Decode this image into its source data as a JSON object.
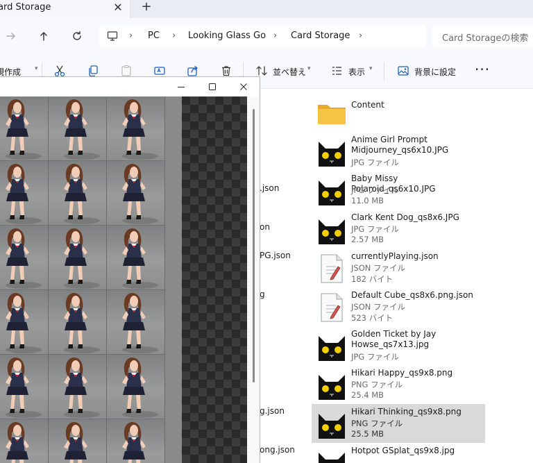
{
  "tab": {
    "title": "Card Storage"
  },
  "address": {
    "crumbs": [
      "PC",
      "Looking Glass Go",
      "Card Storage"
    ]
  },
  "search": {
    "placeholder": "Card Storageの検索"
  },
  "commands": {
    "new_label": "規作成",
    "sort_label": "並べ替え",
    "view_label": "表示",
    "background_label": "背景に設定"
  },
  "partial_names": [
    ".json",
    "on",
    "PG.json",
    "g",
    "g.json",
    "ong.json"
  ],
  "files": [
    {
      "name": "Content",
      "icon": "folder-icon"
    },
    {
      "name": "Anime Girl Prompt Midjourney_qs6x10.JPG",
      "type": "JPG ファイル",
      "icon": "cat-thumbnail-icon"
    },
    {
      "name": "Baby Missy Polaroid_qs6x10.JPG",
      "type": "JPG ファイル",
      "size": "11.0 MB",
      "icon": "cat-thumbnail-icon"
    },
    {
      "name": "Clark Kent Dog_qs8x6.JPG",
      "type": "JPG ファイル",
      "size": "2.57 MB",
      "icon": "cat-thumbnail-icon"
    },
    {
      "name": "currentlyPlaying.json",
      "type": "JSON ファイル",
      "size": "182 バイト",
      "icon": "json-file-icon"
    },
    {
      "name": "Default Cube_qs8x6.png.json",
      "type": "JSON ファイル",
      "size": "523 バイト",
      "icon": "json-file-icon"
    },
    {
      "name": "Golden Ticket by Jay Howse_qs7x13.jpg",
      "type": "JPG ファイル",
      "icon": "cat-thumbnail-icon"
    },
    {
      "name": "Hikari Happy_qs9x8.png",
      "type": "PNG ファイル",
      "size": "25.4 MB",
      "icon": "cat-thumbnail-icon"
    },
    {
      "name": "Hikari Thinking_qs9x8.png",
      "type": "PNG ファイル",
      "size": "25.5 MB",
      "icon": "cat-thumbnail-icon",
      "selected": true
    },
    {
      "name": "Hotpot GSplat_qs9x8.jpg",
      "icon": "cat-thumbnail-icon"
    }
  ],
  "colors": {
    "selection": "#d9d9d9",
    "folder": "#f6c445",
    "nav_bg": "#f7f9fc",
    "tab_bg": "#e9edf3",
    "checker_dark": "#2a2a2a",
    "checker_light": "#3c3c3c"
  }
}
